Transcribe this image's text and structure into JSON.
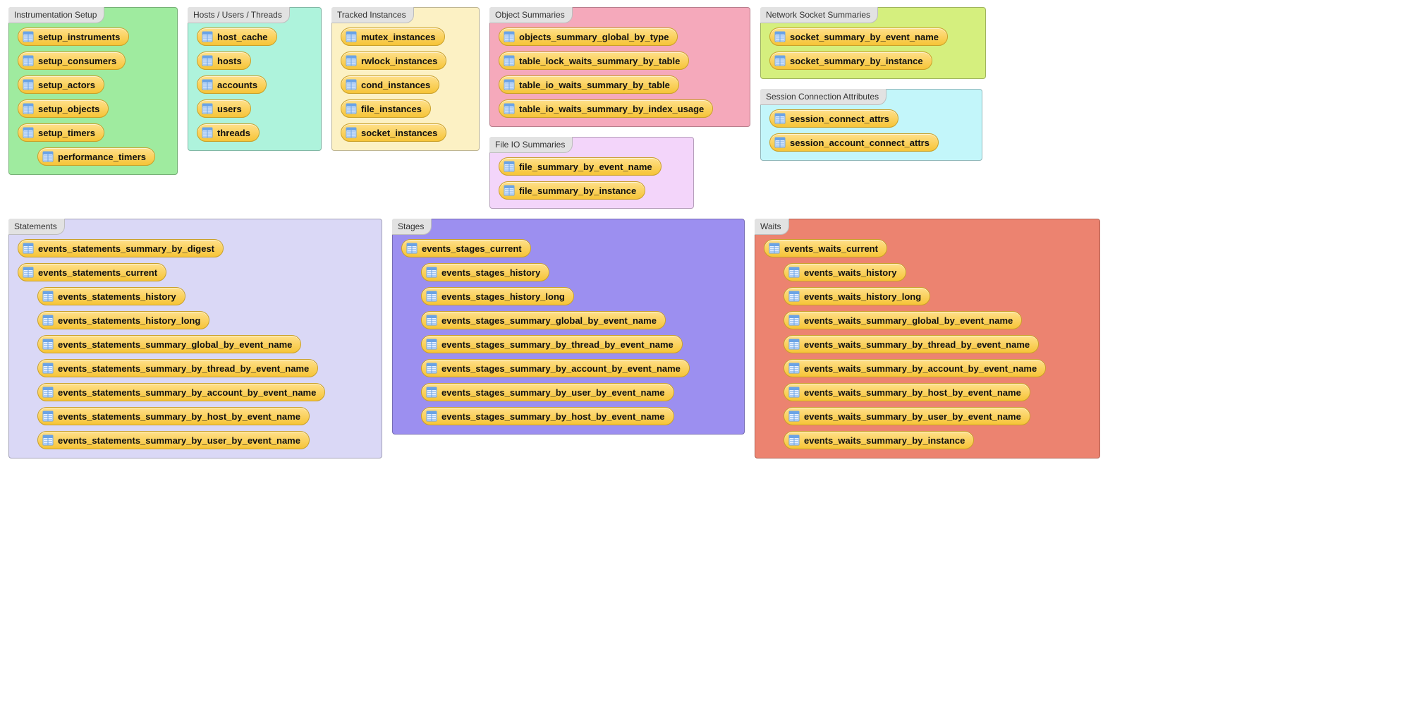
{
  "colors": {
    "group_bg": {
      "instrumentation": "#9FEB9F",
      "hosts": "#AEF3DC",
      "tracked": "#FCF1C4",
      "object_summaries": "#F5A9BB",
      "fileio": "#F3D5FA",
      "network": "#D5EF7E",
      "session": "#C3F6FA",
      "statements": "#DAD8F6",
      "stages": "#9C8FF0",
      "waits": "#EC8370"
    }
  },
  "groups": [
    {
      "id": "instrumentation",
      "title": "Instrumentation Setup",
      "items": [
        {
          "label": "setup_instruments",
          "indent": 0
        },
        {
          "label": "setup_consumers",
          "indent": 0
        },
        {
          "label": "setup_actors",
          "indent": 0
        },
        {
          "label": "setup_objects",
          "indent": 0
        },
        {
          "label": "setup_timers",
          "indent": 0
        },
        {
          "label": "performance_timers",
          "indent": 1
        }
      ]
    },
    {
      "id": "hosts",
      "title": "Hosts / Users / Threads",
      "items": [
        {
          "label": "host_cache",
          "indent": 0
        },
        {
          "label": "hosts",
          "indent": 0
        },
        {
          "label": "accounts",
          "indent": 0
        },
        {
          "label": "users",
          "indent": 0
        },
        {
          "label": "threads",
          "indent": 0
        }
      ]
    },
    {
      "id": "tracked",
      "title": "Tracked Instances",
      "items": [
        {
          "label": "mutex_instances",
          "indent": 0
        },
        {
          "label": "rwlock_instances",
          "indent": 0
        },
        {
          "label": "cond_instances",
          "indent": 0
        },
        {
          "label": "file_instances",
          "indent": 0
        },
        {
          "label": "socket_instances",
          "indent": 0
        }
      ]
    },
    {
      "id": "object_summaries",
      "title": "Object Summaries",
      "items": [
        {
          "label": "objects_summary_global_by_type",
          "indent": 0
        },
        {
          "label": "table_lock_waits_summary_by_table",
          "indent": 0
        },
        {
          "label": "table_io_waits_summary_by_table",
          "indent": 0
        },
        {
          "label": "table_io_waits_summary_by_index_usage",
          "indent": 0
        }
      ]
    },
    {
      "id": "fileio",
      "title": "File IO Summaries",
      "items": [
        {
          "label": "file_summary_by_event_name",
          "indent": 0
        },
        {
          "label": "file_summary_by_instance",
          "indent": 0
        }
      ]
    },
    {
      "id": "network",
      "title": "Network Socket Summaries",
      "items": [
        {
          "label": "socket_summary_by_event_name",
          "indent": 0
        },
        {
          "label": "socket_summary_by_instance",
          "indent": 0
        }
      ]
    },
    {
      "id": "session",
      "title": "Session Connection Attributes",
      "items": [
        {
          "label": "session_connect_attrs",
          "indent": 0
        },
        {
          "label": "session_account_connect_attrs",
          "indent": 0
        }
      ]
    },
    {
      "id": "statements",
      "title": "Statements",
      "items": [
        {
          "label": "events_statements_summary_by_digest",
          "indent": 0
        },
        {
          "label": "events_statements_current",
          "indent": 0
        },
        {
          "label": "events_statements_history",
          "indent": 1
        },
        {
          "label": "events_statements_history_long",
          "indent": 1
        },
        {
          "label": "events_statements_summary_global_by_event_name",
          "indent": 1
        },
        {
          "label": "events_statements_summary_by_thread_by_event_name",
          "indent": 1
        },
        {
          "label": "events_statements_summary_by_account_by_event_name",
          "indent": 1
        },
        {
          "label": "events_statements_summary_by_host_by_event_name",
          "indent": 1
        },
        {
          "label": "events_statements_summary_by_user_by_event_name",
          "indent": 1
        }
      ]
    },
    {
      "id": "stages",
      "title": "Stages",
      "items": [
        {
          "label": "events_stages_current",
          "indent": 0
        },
        {
          "label": "events_stages_history",
          "indent": 1
        },
        {
          "label": "events_stages_history_long",
          "indent": 1
        },
        {
          "label": "events_stages_summary_global_by_event_name",
          "indent": 1
        },
        {
          "label": "events_stages_summary_by_thread_by_event_name",
          "indent": 1
        },
        {
          "label": "events_stages_summary_by_account_by_event_name",
          "indent": 1
        },
        {
          "label": "events_stages_summary_by_user_by_event_name",
          "indent": 1
        },
        {
          "label": "events_stages_summary_by_host_by_event_name",
          "indent": 1
        }
      ]
    },
    {
      "id": "waits",
      "title": "Waits",
      "items": [
        {
          "label": "events_waits_current",
          "indent": 0
        },
        {
          "label": "events_waits_history",
          "indent": 1
        },
        {
          "label": "events_waits_history_long",
          "indent": 1
        },
        {
          "label": "events_waits_summary_global_by_event_name",
          "indent": 1
        },
        {
          "label": "events_waits_summary_by_thread_by_event_name",
          "indent": 1
        },
        {
          "label": "events_waits_summary_by_account_by_event_name",
          "indent": 1
        },
        {
          "label": "events_waits_summary_by_host_by_event_name",
          "indent": 1
        },
        {
          "label": "events_waits_summary_by_user_by_event_name",
          "indent": 1
        },
        {
          "label": "events_waits_summary_by_instance",
          "indent": 1
        }
      ]
    }
  ],
  "layout": {
    "row1": [
      "instrumentation",
      "hosts",
      "tracked",
      "object_summaries+fileio",
      "network+session"
    ],
    "row2": [
      "statements",
      "stages",
      "waits"
    ]
  },
  "widths": {
    "instrumentation": 240,
    "hosts": 190,
    "tracked": 210,
    "object_summaries": 370,
    "fileio": 290,
    "network": 320,
    "session": 315,
    "statements": 530,
    "stages": 500,
    "waits": 490
  }
}
